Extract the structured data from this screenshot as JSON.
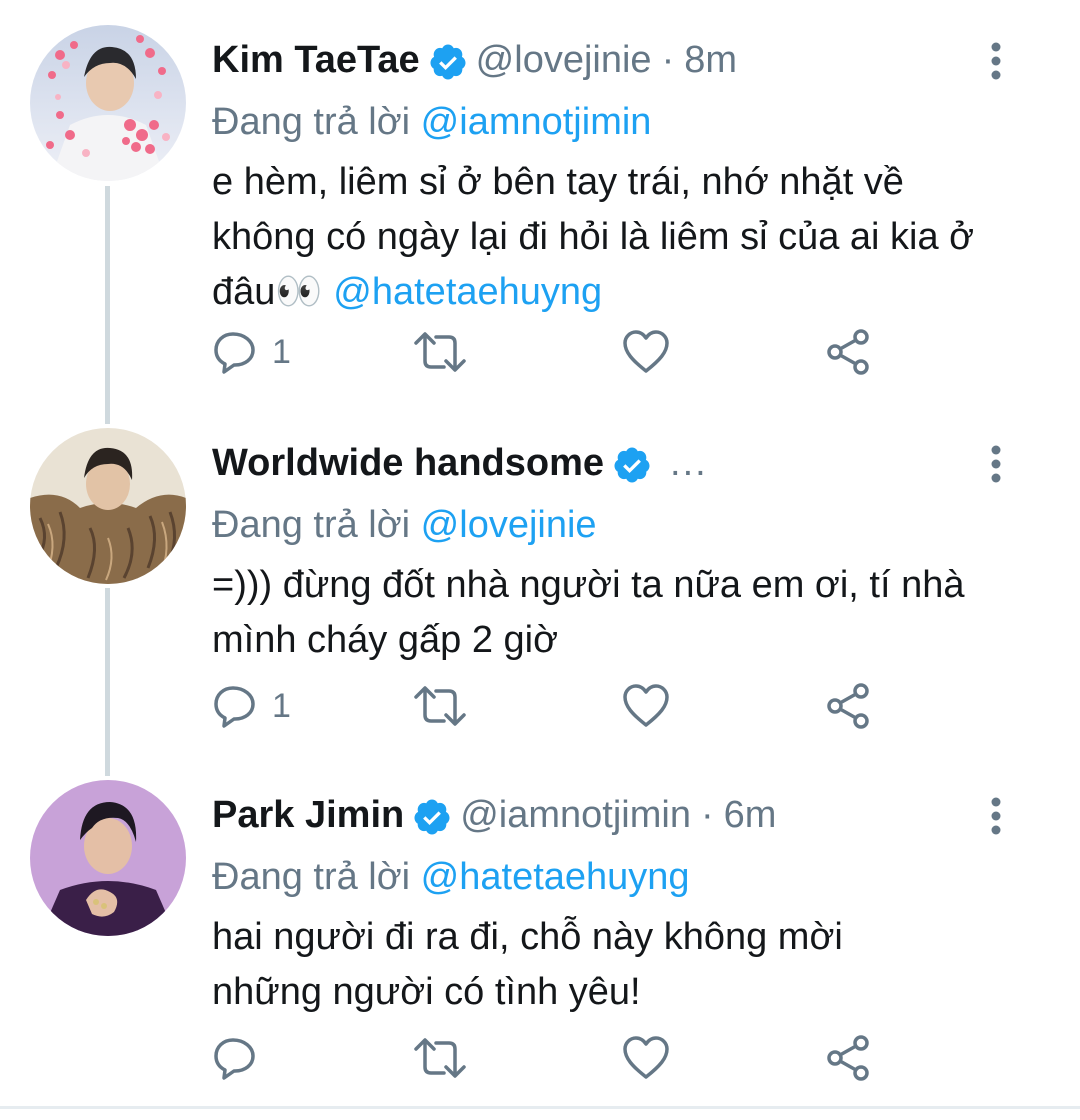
{
  "tweets": [
    {
      "name": "Kim TaeTae",
      "handle": "@lovejinie",
      "dot": "·",
      "time": "8m",
      "replying_prefix": "Đang trả lời",
      "replying_to": "@iamnotjimin",
      "text": "e hèm, liêm sỉ ở bên tay trái, nhớ nhặt về không có ngày lại đi hỏi là liêm sỉ của ai kia ở đâu👀",
      "text_mention": "@hatetaehuyng",
      "reply_count": "1",
      "avatar_icon": "avatar-photo-hearts"
    },
    {
      "name": "Worldwide handsome",
      "handle_truncated": "...",
      "replying_prefix": "Đang trả lời",
      "replying_to": "@lovejinie",
      "text": "=))) đừng đốt nhà người ta nữa em ơi, tí nhà mình cháy gấp 2 giờ",
      "reply_count": "1",
      "avatar_icon": "avatar-photo-fur-coat"
    },
    {
      "name": "Park Jimin",
      "handle": "@iamnotjimin",
      "dot": "·",
      "time": "6m",
      "replying_prefix": "Đang trả lời",
      "replying_to": "@hatetaehuyng",
      "text": "hai người đi ra đi, chỗ này không mời những người có tình yêu!",
      "reply_count": "",
      "avatar_icon": "avatar-photo-purple"
    }
  ],
  "colors": {
    "accent": "#1da1f2",
    "secondary_text": "#657786",
    "primary_text": "#14171a",
    "thread_line": "#cfd9de",
    "icon": "#657786"
  },
  "icons": [
    "verified-badge-icon",
    "more-vertical-icon",
    "reply-icon",
    "retweet-icon",
    "like-icon",
    "share-icon"
  ]
}
